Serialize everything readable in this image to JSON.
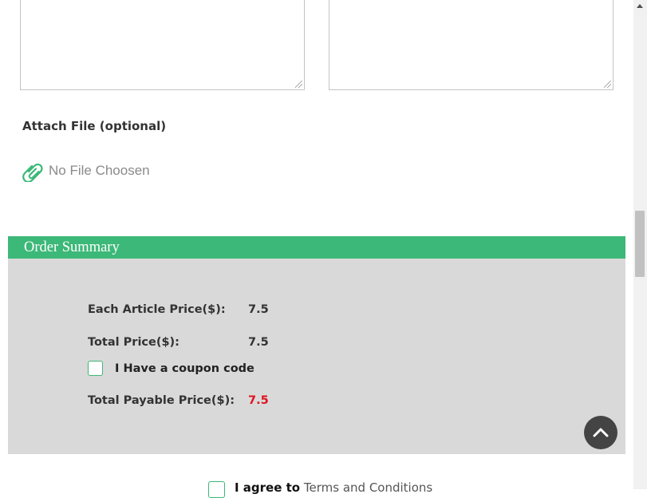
{
  "attach": {
    "label": "Attach File (optional)",
    "no_file_text": "No File Choosen",
    "icon": "paperclip-icon"
  },
  "order_summary": {
    "title": "Order Summary",
    "each_article_price_label": "Each Article Price($):",
    "each_article_price_value": "7.5",
    "total_price_label": "Total Price($):",
    "total_price_value": "7.5",
    "coupon_label": "I Have a coupon code",
    "total_payable_label": "Total Payable Price($):",
    "total_payable_value": "7.5"
  },
  "agree": {
    "prefix": "I agree to",
    "link": "Terms and Conditions"
  },
  "colors": {
    "accent_green": "#3cb878",
    "panel_gray": "#d9d9d9",
    "payable_red": "#e0131f",
    "back_to_top_bg": "#444444"
  }
}
